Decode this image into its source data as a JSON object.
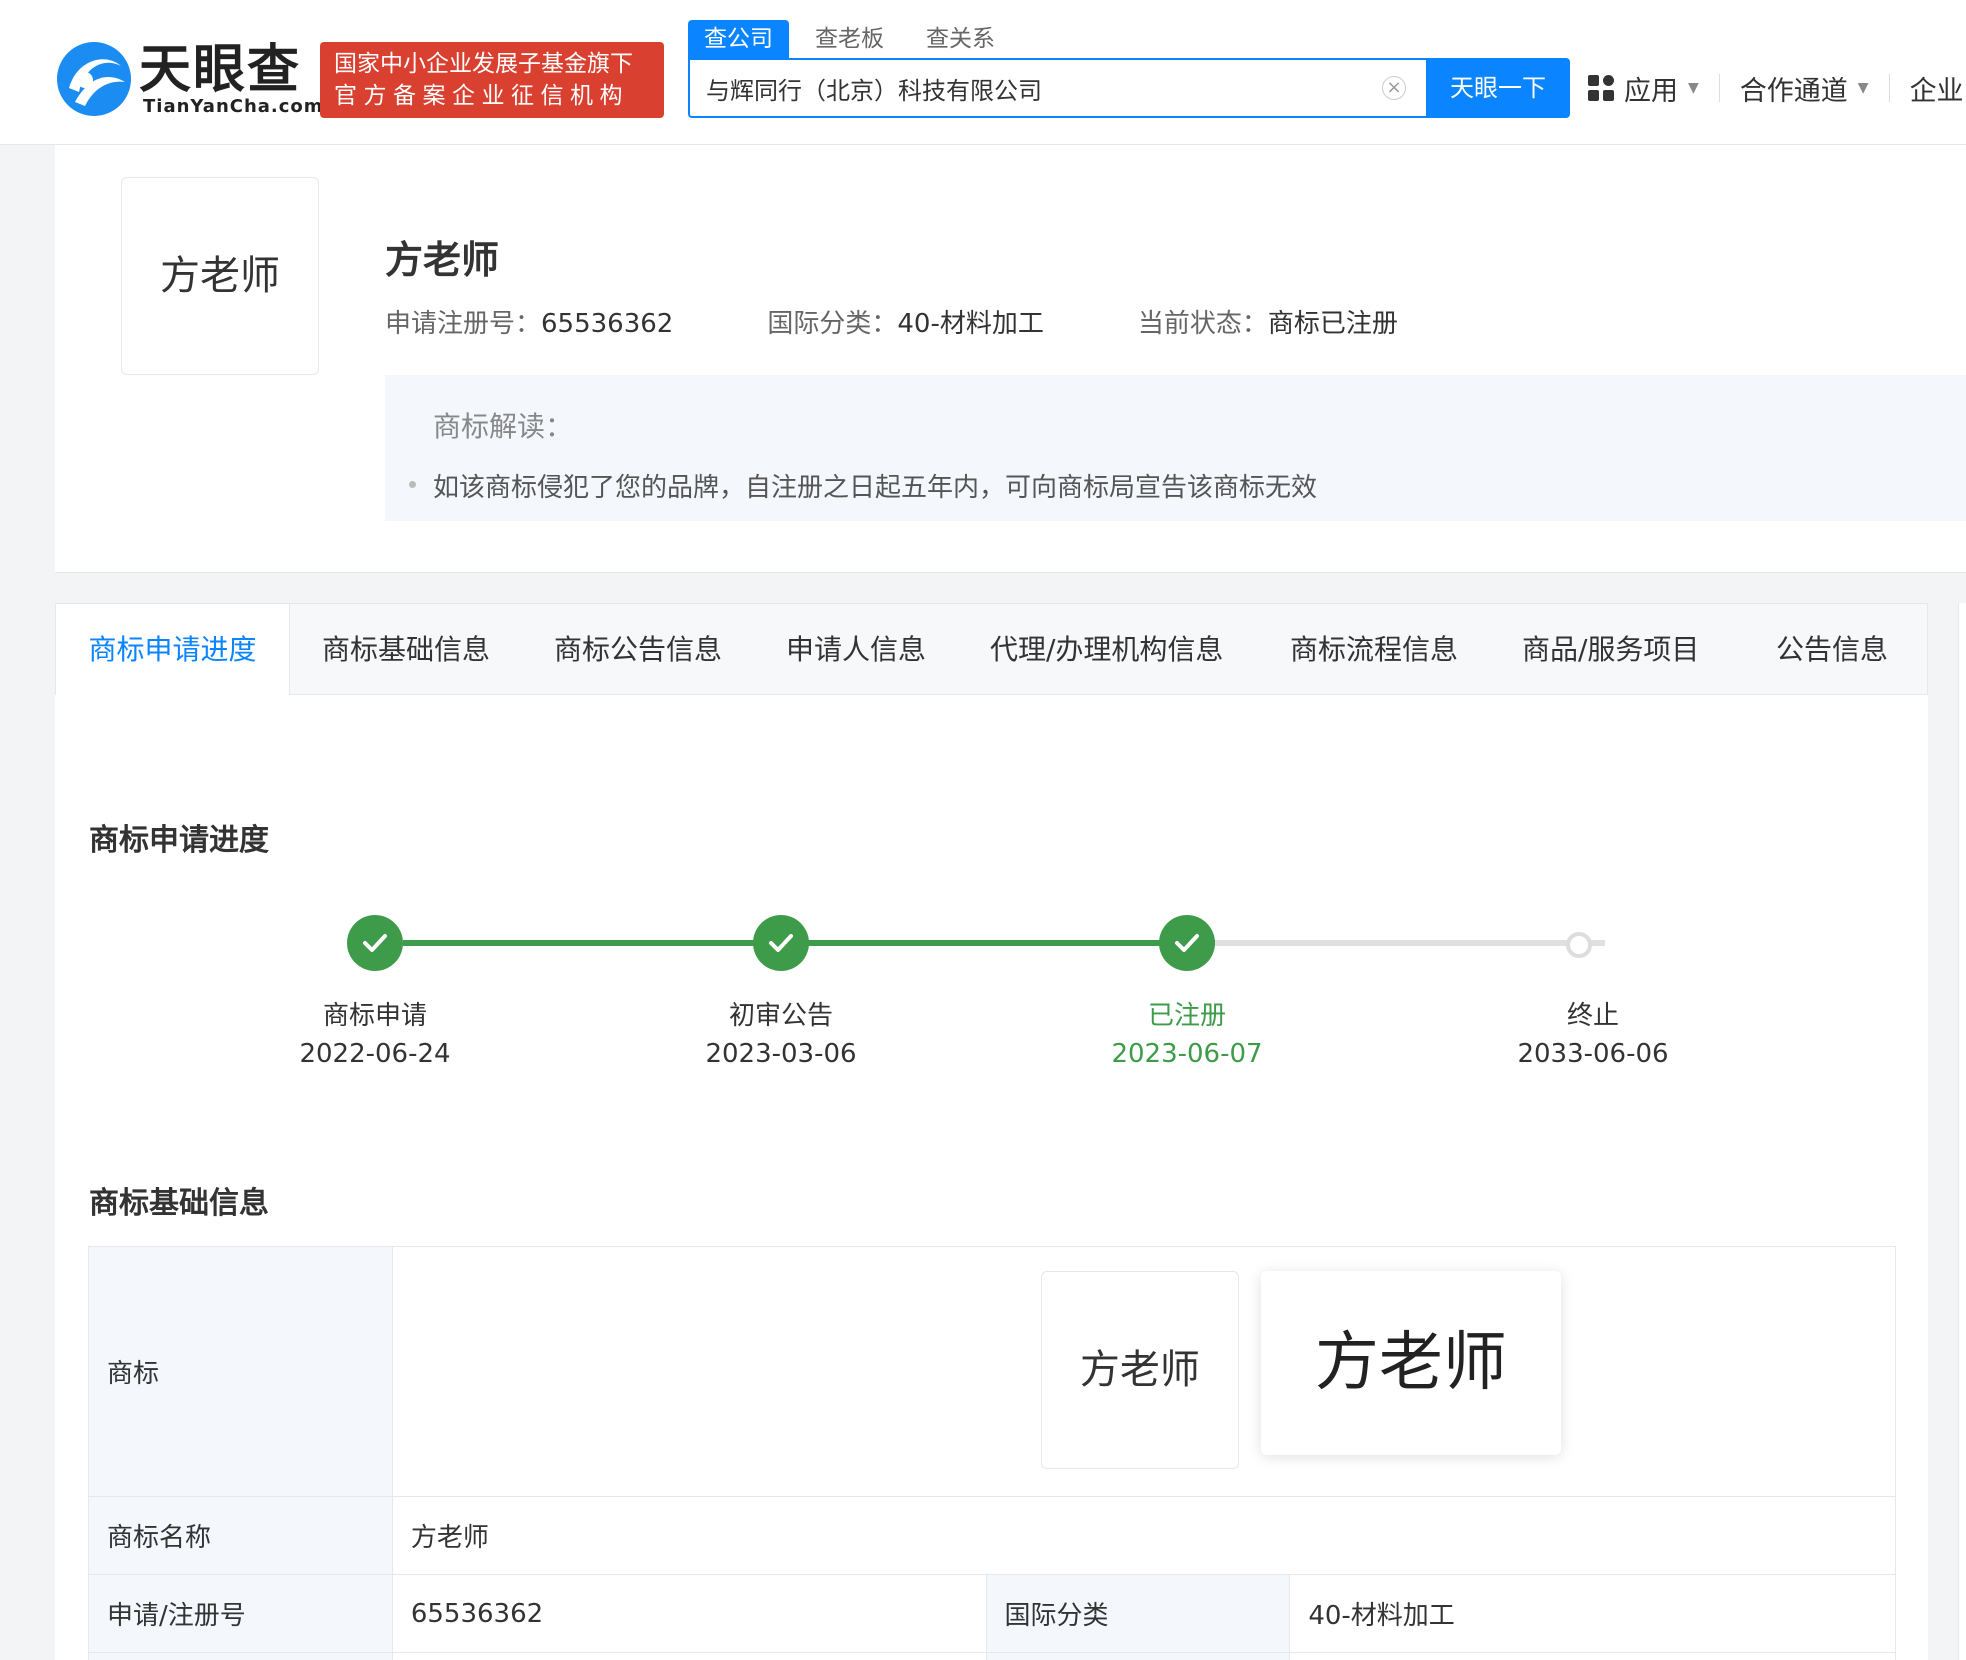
{
  "header": {
    "logo_cn": "天眼查",
    "logo_en": "TianYanCha.com",
    "badge_line1": "国家中小企业发展子基金旗下",
    "badge_line2": "官方备案企业征信机构",
    "search_tabs": [
      "查公司",
      "查老板",
      "查关系"
    ],
    "search_value": "与辉同行（北京）科技有限公司",
    "search_clear": "×",
    "search_button": "天眼一下",
    "nav": {
      "apps": "应用",
      "partner": "合作通道",
      "enterprise": "企业"
    },
    "accent_color": "#0a84ff",
    "badge_color": "#d94030"
  },
  "trademark": {
    "image_text": "方老师",
    "name": "方老师",
    "reg_no_label": "申请注册号：",
    "reg_no": "65536362",
    "class_label": "国际分类：",
    "class_value": "40-材料加工",
    "status_label": "当前状态：",
    "status_value": "商标已注册",
    "interp_title": "商标解读：",
    "interp_text": "如该商标侵犯了您的品牌，自注册之日起五年内，可向商标局宣告该商标无效"
  },
  "tabs": [
    "商标申请进度",
    "商标基础信息",
    "商标公告信息",
    "申请人信息",
    "代理/办理机构信息",
    "商标流程信息",
    "商品/服务项目",
    "公告信息"
  ],
  "progress": {
    "title": "商标申请进度",
    "steps": [
      {
        "label": "商标申请",
        "date": "2022-06-24",
        "done": true
      },
      {
        "label": "初审公告",
        "date": "2023-03-06",
        "done": true
      },
      {
        "label": "已注册",
        "date": "2023-06-07",
        "done": true
      },
      {
        "label": "终止",
        "date": "2033-06-06",
        "done": false
      }
    ],
    "done_color": "#3d9b4a"
  },
  "basic_info": {
    "title": "商标基础信息",
    "mark_label": "商标",
    "mark_image_text": "方老师",
    "name_label": "商标名称",
    "name_value": "方老师",
    "reg_no_label": "申请/注册号",
    "reg_no_value": "65536362",
    "class_label": "国际分类",
    "class_value": "40-材料加工"
  }
}
